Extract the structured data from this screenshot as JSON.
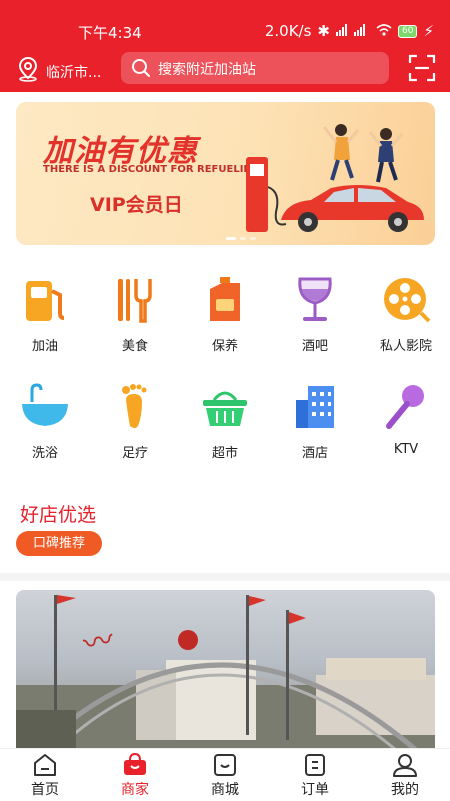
{
  "status_bar": {
    "time": "下午4:34",
    "network_speed": "2.0K/s",
    "battery": "60"
  },
  "header": {
    "location": "临沂市...",
    "search_placeholder": "搜索附近加油站"
  },
  "banner": {
    "title": "加油有优惠",
    "subtitle": "THERE IS A DISCOUNT FOR REFUELING",
    "vip_label": "VIP会员日",
    "slide_count": 3,
    "active_slide": 1
  },
  "categories": [
    {
      "label": "加油",
      "icon": "fuel-pump-icon"
    },
    {
      "label": "美食",
      "icon": "fork-knife-icon"
    },
    {
      "label": "保养",
      "icon": "oil-can-icon"
    },
    {
      "label": "酒吧",
      "icon": "wine-glass-icon"
    },
    {
      "label": "私人影院",
      "icon": "film-reel-icon"
    },
    {
      "label": "洗浴",
      "icon": "bathtub-icon"
    },
    {
      "label": "足疗",
      "icon": "footprint-icon"
    },
    {
      "label": "超市",
      "icon": "basket-icon"
    },
    {
      "label": "酒店",
      "icon": "hotel-building-icon"
    },
    {
      "label": "KTV",
      "icon": "microphone-icon"
    }
  ],
  "section": {
    "title": "好店优选",
    "tag": "口碑推荐"
  },
  "tabs": [
    {
      "label": "首页",
      "icon": "home-icon",
      "active": false
    },
    {
      "label": "商家",
      "icon": "shop-bag-icon",
      "active": true
    },
    {
      "label": "商城",
      "icon": "mall-icon",
      "active": false
    },
    {
      "label": "订单",
      "icon": "order-icon",
      "active": false
    },
    {
      "label": "我的",
      "icon": "profile-icon",
      "active": false
    }
  ],
  "colors": {
    "brand": "#e8212b",
    "tag": "#f05a24"
  }
}
